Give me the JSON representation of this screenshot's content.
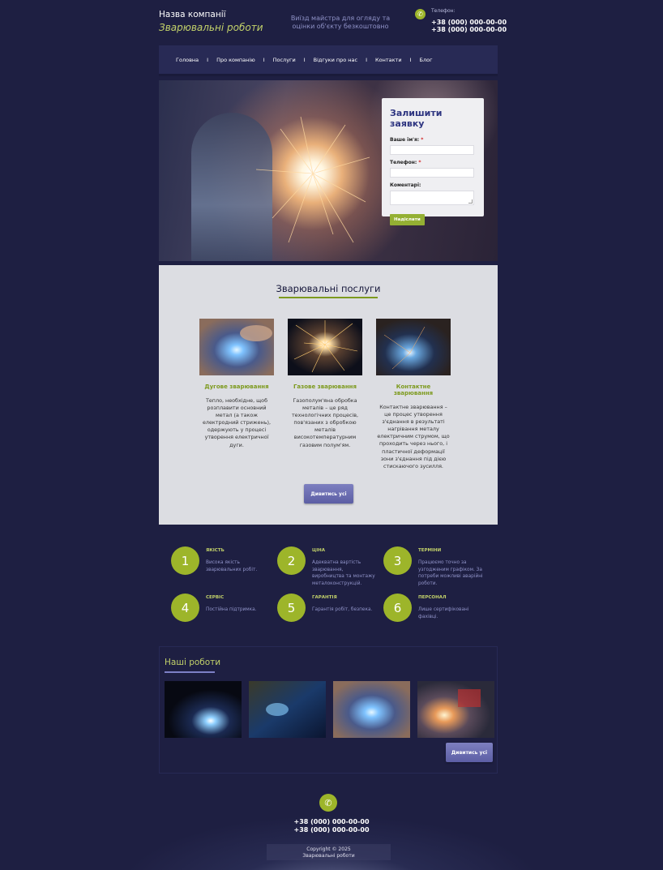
{
  "header": {
    "company_name": "Назва компанії",
    "tagline": "Зварювальні роботи",
    "note": "Виїзд майстра для огляду та оцінки об'єкту безкоштовно",
    "phone_label": "Телефон:",
    "phones": [
      "+38 (000) 000-00-00",
      "+38 (000) 000-00-00"
    ]
  },
  "nav": {
    "items": [
      "Головна",
      "Про компанію",
      "Послуги",
      "Відгуки про нас",
      "Контакти",
      "Блог"
    ],
    "separator": "I"
  },
  "request_form": {
    "title": "Залишити заявку",
    "name_label": "Ваше ім'я:",
    "phone_label": "Телефон:",
    "comment_label": "Коментарі:",
    "required_mark": "*",
    "submit_label": "Надіслати"
  },
  "services": {
    "title": "Зварювальні послуги",
    "items": [
      {
        "name": "Дугове зварювання",
        "desc": "Тепло, необхідне, щоб розплавити основний метал (а також електродний стрижень), одержують у процесі утворення електричної дуги."
      },
      {
        "name": "Газове зварювання",
        "desc": "Газополум'яна обробка металів – це ряд технологічних процесів, пов'язаних з обробкою металів високотемпературним газовим полум'ям."
      },
      {
        "name": "Контактне зварювання",
        "desc": "Контактне зварювання – це процес утворення з'єднання в результаті нагрівання металу електричним струмом, що проходить через нього, і пластичної деформації зони з'єднання під дією стискаючого зусилля."
      }
    ],
    "view_all_label": "Дивитись усі"
  },
  "features": [
    {
      "number": "1",
      "title": "ЯКІСТЬ",
      "desc": "Висока якість зварювальних робіт."
    },
    {
      "number": "2",
      "title": "ЦІНА",
      "desc": "Адекватна вартість зварювання, виробництва та монтажу металоконструкцій."
    },
    {
      "number": "3",
      "title": "ТЕРМІНИ",
      "desc": "Працюємо точно за узгодженим графіком. За потреби можливі аварійні роботи."
    },
    {
      "number": "4",
      "title": "СЕРВІС",
      "desc": "Постійна підтримка."
    },
    {
      "number": "5",
      "title": "ГАРАНТІЯ",
      "desc": "Гарантія робіт, безпека."
    },
    {
      "number": "6",
      "title": "ПЕРСОНАЛ",
      "desc": "Лише сертифіковані фахівці."
    }
  ],
  "works": {
    "title": "Наші роботи",
    "view_all_label": "Дивитись усі"
  },
  "footer": {
    "phones": [
      "+38 (000) 000-00-00",
      "+38 (000) 000-00-00"
    ],
    "copyright": "Copyright © 2025",
    "copyright_sub": "Зварювальні роботи"
  },
  "colors": {
    "background": "#1e1f42",
    "accent_green": "#9db52a",
    "accent_purple": "#6e70b4",
    "panel": "#dcdde2"
  },
  "icons": {
    "phone": "phone-icon"
  }
}
